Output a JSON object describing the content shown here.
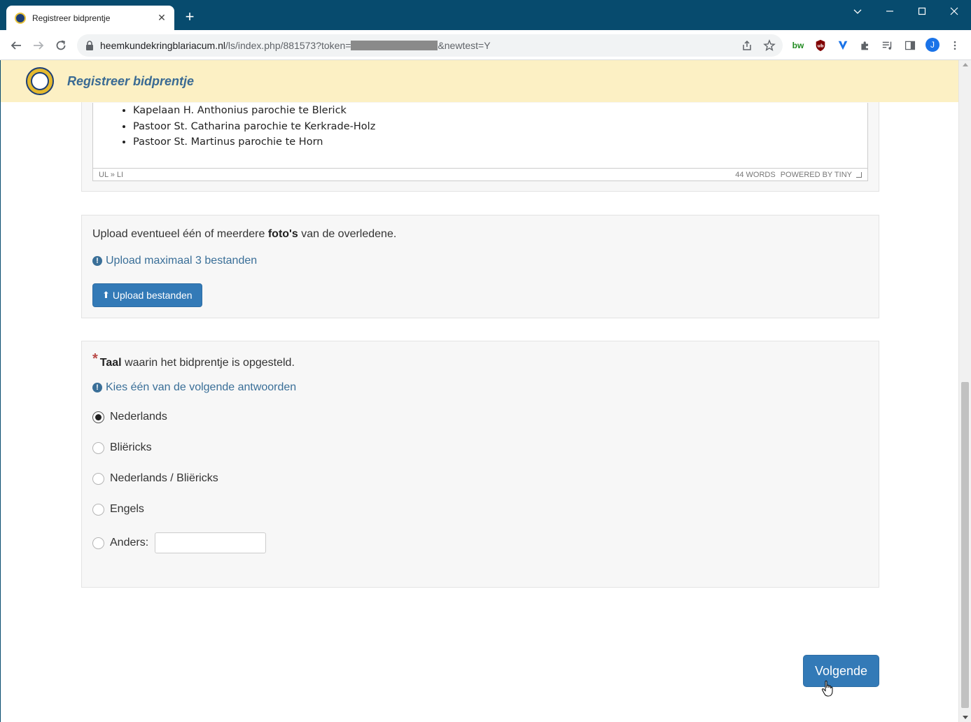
{
  "browser": {
    "tab_title": "Registreer bidprentje",
    "new_tab": "+",
    "url_main": "heemkundekringblariacum.nl",
    "url_path": "/ls/index.php/881573?token=",
    "url_suffix": "&newtest=Y",
    "profile_initial": "J",
    "ext_bw": "bw",
    "ext_ub": "ub"
  },
  "site": {
    "title": "Registreer bidprentje"
  },
  "editor": {
    "items": [
      "Kapelaan H. Anthonius parochie te Blerick",
      "Pastoor St. Catharina parochie te Kerkrade-Holz",
      "Pastoor St. Martinus parochie te Horn"
    ],
    "path": "UL » LI",
    "word_count": "44 WORDS",
    "powered": "POWERED BY TINY"
  },
  "upload": {
    "text_before": "Upload eventueel één of meerdere ",
    "text_bold": "foto's",
    "text_after": " van de overledene.",
    "help": "Upload maximaal 3 bestanden",
    "button": "Upload bestanden"
  },
  "language": {
    "asterisk": "*",
    "label_bold": "Taal",
    "label_rest": " waarin het bidprentje is opgesteld.",
    "help": "Kies één van de volgende antwoorden",
    "options": [
      "Nederlands",
      "Bliëricks",
      "Nederlands / Bliëricks",
      "Engels"
    ],
    "other_label": "Anders:",
    "other_value": "",
    "selected": "Nederlands"
  },
  "nav": {
    "next": "Volgende"
  }
}
